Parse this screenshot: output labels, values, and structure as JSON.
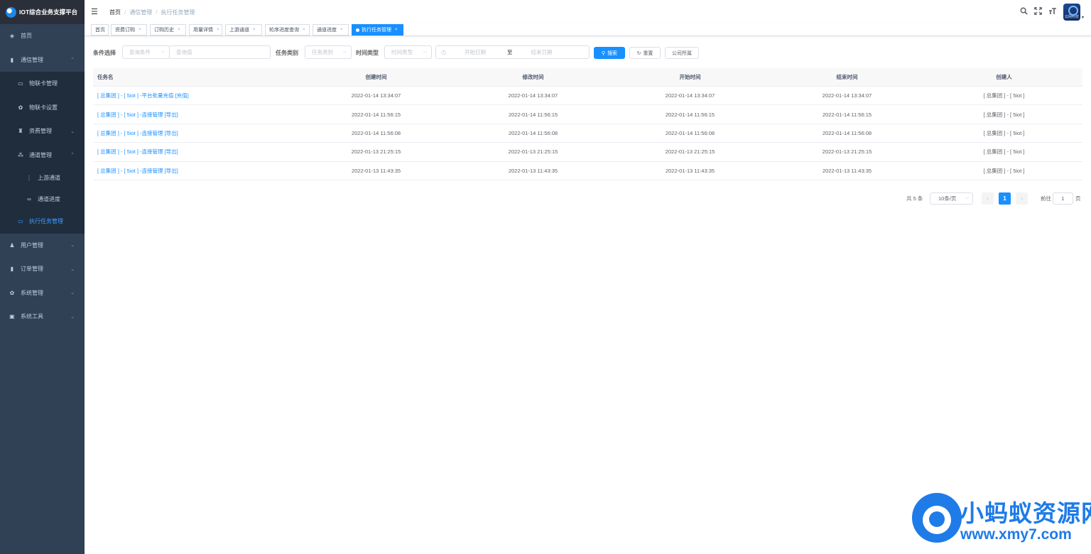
{
  "app": {
    "title": "IOT综合业务支撑平台"
  },
  "sidebar": {
    "items": [
      {
        "label": "首页",
        "icon": "dashboard-icon",
        "glyph": "◈",
        "level": 1,
        "arrow": ""
      },
      {
        "label": "通信管理",
        "icon": "card-icon",
        "glyph": "▮",
        "level": 1,
        "arrow": "^"
      },
      {
        "label": "物联卡管理",
        "icon": "sim-card-icon",
        "glyph": "▭",
        "level": 2,
        "arrow": ""
      },
      {
        "label": "物联卡设置",
        "icon": "gear-icon",
        "glyph": "✿",
        "level": 2,
        "arrow": ""
      },
      {
        "label": "资费管理",
        "icon": "money-icon",
        "glyph": "♜",
        "level": 2,
        "arrow": "v"
      },
      {
        "label": "通道管理",
        "icon": "tree-icon",
        "glyph": "⁂",
        "level": 2,
        "arrow": "^"
      },
      {
        "label": "上游通道",
        "icon": "upstream-icon",
        "glyph": "⋮",
        "level": 3,
        "arrow": ""
      },
      {
        "label": "通道进度",
        "icon": "link-icon",
        "glyph": "∞",
        "level": 3,
        "arrow": ""
      },
      {
        "label": "执行任务管理",
        "icon": "monitor-icon",
        "glyph": "▭",
        "level": 2,
        "arrow": "",
        "active": true
      },
      {
        "label": "用户管理",
        "icon": "user-icon",
        "glyph": "♟",
        "level": 1,
        "arrow": "v"
      },
      {
        "label": "订单管理",
        "icon": "chart-icon",
        "glyph": "▮",
        "level": 1,
        "arrow": "v"
      },
      {
        "label": "系统管理",
        "icon": "settings-icon",
        "glyph": "✿",
        "level": 1,
        "arrow": "v"
      },
      {
        "label": "系统工具",
        "icon": "toolbox-icon",
        "glyph": "▣",
        "level": 1,
        "arrow": "v"
      }
    ]
  },
  "header": {
    "breadcrumb": [
      "首页",
      "通信管理",
      "执行任务管理"
    ],
    "avatar_text": "云网科技"
  },
  "tags": [
    {
      "label": "首页",
      "closable": false
    },
    {
      "label": "资费订购",
      "closable": true
    },
    {
      "label": "订购历史",
      "closable": true
    },
    {
      "label": "用量详情",
      "closable": true
    },
    {
      "label": "上游通道",
      "closable": true
    },
    {
      "label": "轮序进度查询",
      "closable": true
    },
    {
      "label": "通道进度",
      "closable": true
    },
    {
      "label": "执行任务管理",
      "closable": true,
      "active": true
    }
  ],
  "filters": {
    "condition_label": "条件选择",
    "condition_placeholder": "查询条件",
    "query_placeholder": "查询值",
    "task_type_label": "任务类别",
    "task_type_placeholder": "任务类别",
    "time_type_label": "时间类型",
    "time_type_placeholder": "时间类型",
    "start_date_placeholder": "开始日期",
    "range_sep": "至",
    "end_date_placeholder": "结束日期",
    "search_label": "搜索",
    "reset_label": "重置",
    "company_label": "公司所属"
  },
  "table": {
    "columns": [
      "任务名",
      "创建时间",
      "修改时间",
      "开始时间",
      "结束时间",
      "创建人"
    ],
    "rows": [
      [
        "[ 总集团 ] - [ 5iot ] -平台批量充值 [充值]",
        "2022-01-14 13:34:07",
        "2022-01-14 13:34:07",
        "2022-01-14 13:34:07",
        "2022-01-14 13:34:07",
        "[ 总集团 ] - [ 5iot ]"
      ],
      [
        "[ 总集团 ] - [ 5iot ] -连接管理 [导出]",
        "2022-01-14 11:56:15",
        "2022-01-14 11:56:15",
        "2022-01-14 11:56:15",
        "2022-01-14 11:56:15",
        "[ 总集团 ] - [ 5iot ]"
      ],
      [
        "[ 总集团 ] - [ 5iot ] -连接管理 [导出]",
        "2022-01-14 11:56:08",
        "2022-01-14 11:56:08",
        "2022-01-14 11:56:08",
        "2022-01-14 11:56:08",
        "[ 总集团 ] - [ 5iot ]"
      ],
      [
        "[ 总集团 ] - [ 5iot ] -连接管理 [导出]",
        "2022-01-13 21:25:15",
        "2022-01-13 21:25:15",
        "2022-01-13 21:25:15",
        "2022-01-13 21:25:15",
        "[ 总集团 ] - [ 5iot ]"
      ],
      [
        "[ 总集团 ] - [ 5iot ] -连接管理 [导出]",
        "2022-01-13 11:43:35",
        "2022-01-13 11:43:35",
        "2022-01-13 11:43:35",
        "2022-01-13 11:43:35",
        "[ 总集团 ] - [ 5iot ]"
      ]
    ]
  },
  "pagination": {
    "total_text": "共 5 条",
    "page_size": "10条/页",
    "current_page": "1",
    "goto_label": "前往",
    "goto_value": "1",
    "page_unit": "页"
  },
  "watermark": {
    "title": "小蚂蚁资源网",
    "url": "www.xmy7.com"
  },
  "colors": {
    "sidebar_bg": "#304156",
    "primary": "#1890ff",
    "watermark": "#1e7be8"
  }
}
